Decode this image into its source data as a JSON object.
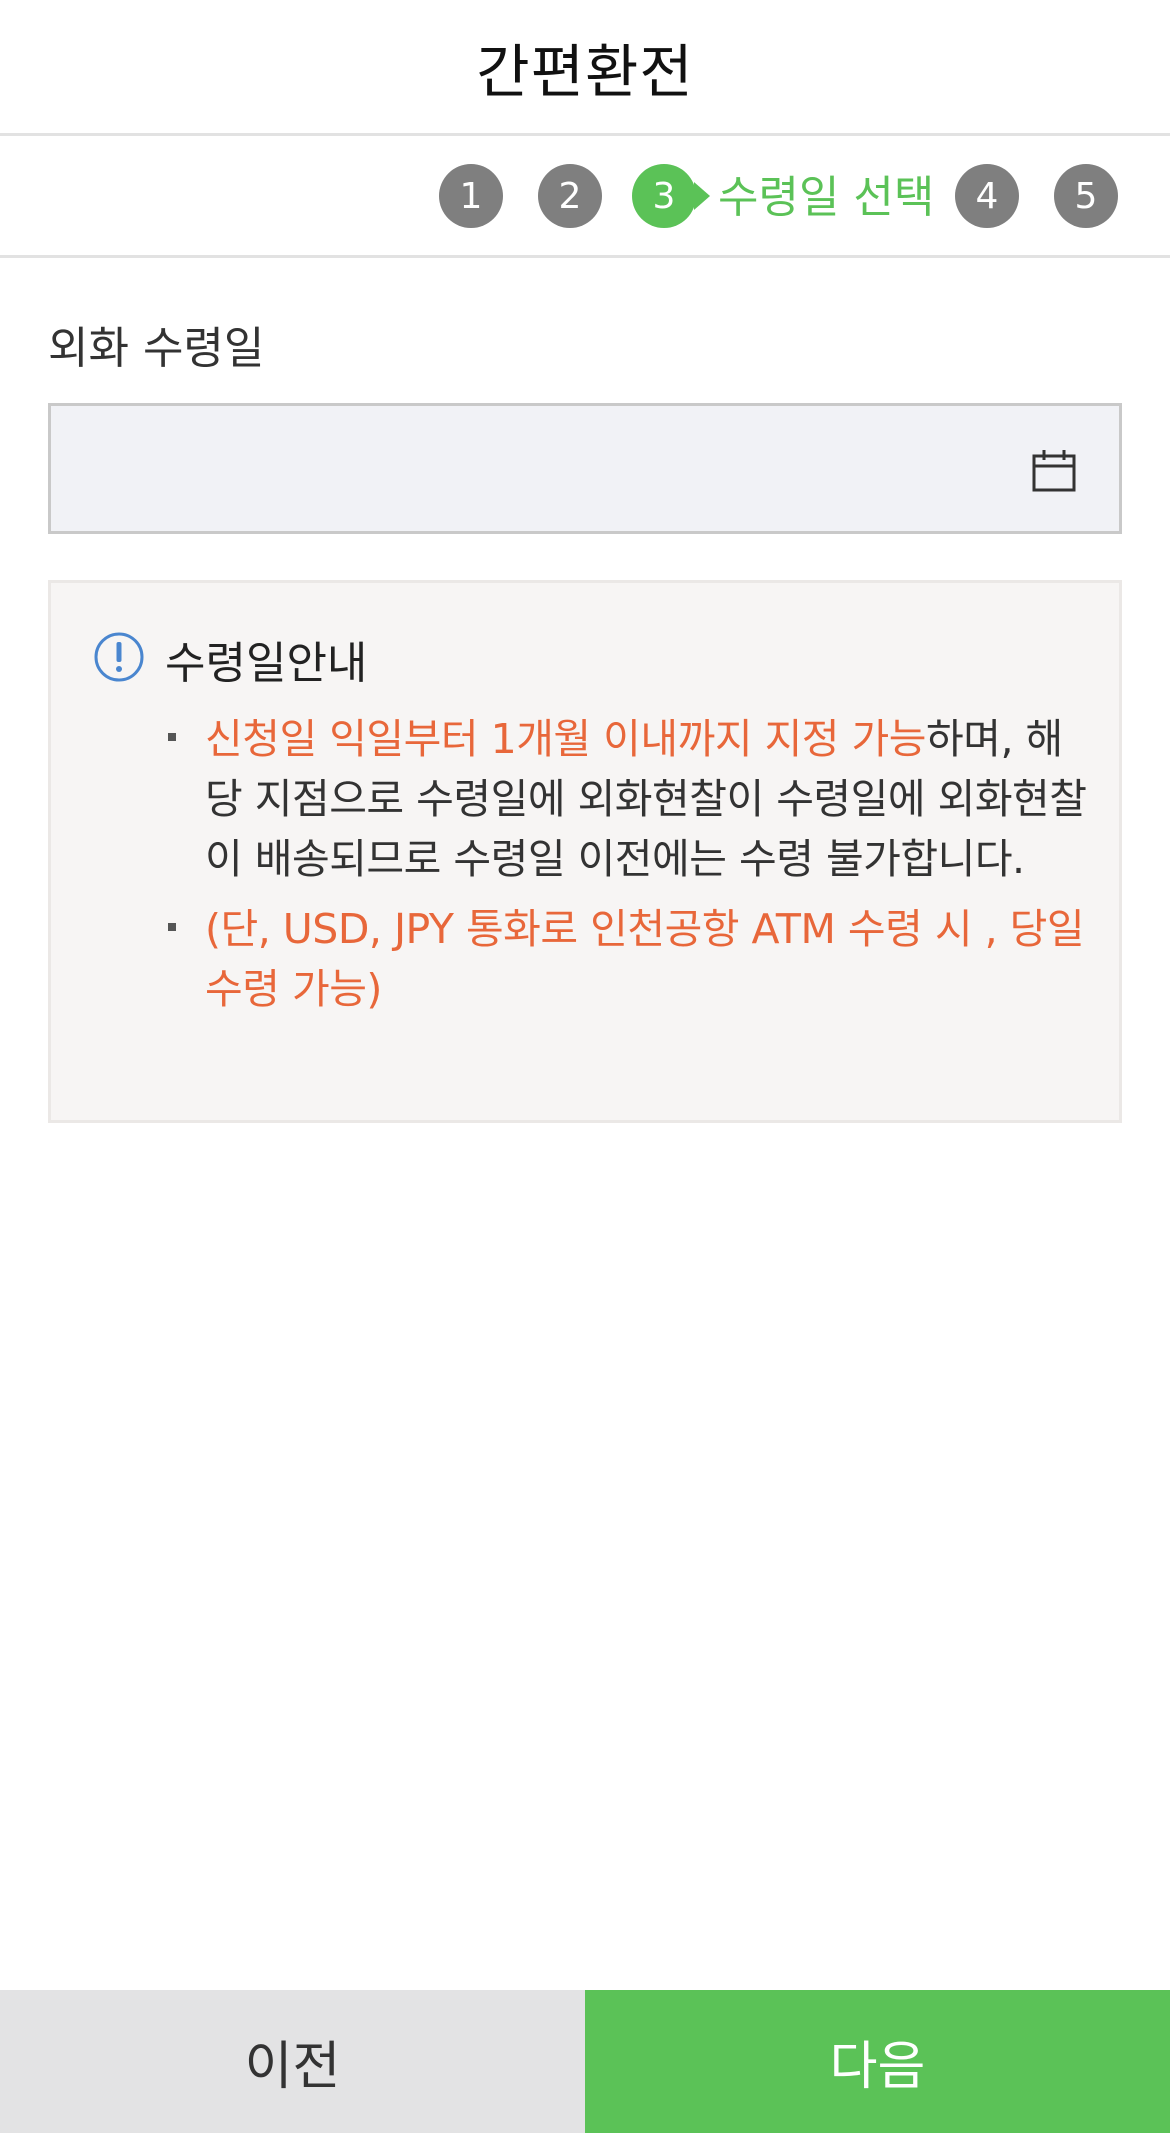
{
  "header": {
    "title": "간편환전"
  },
  "steps": {
    "items": [
      "1",
      "2",
      "3",
      "4",
      "5"
    ],
    "active_label": "수령일 선택"
  },
  "form": {
    "date_label": "외화 수령일",
    "date_value": "",
    "icon": "calendar-icon"
  },
  "notice": {
    "title": "수령일안내",
    "icon": "exclamation-circle-icon",
    "item1_highlight": "신청일  익일부터 1개월 이내까지 지정 가능",
    "item1_rest": "하며, 해당 지점으로 수령일에 외화현찰이 수령일에 외화현찰이 배송되므로 수령일 이전에는 수령 불가합니다.",
    "item2": "(단, USD, JPY 통화로 인천공항 ATM 수령 시 , 당일 수령 가능)"
  },
  "buttons": {
    "prev": "이전",
    "next": "다음"
  },
  "colors": {
    "accent": "#5bc257",
    "highlight": "#e8673a",
    "inactive_step": "#7f7f7f"
  }
}
